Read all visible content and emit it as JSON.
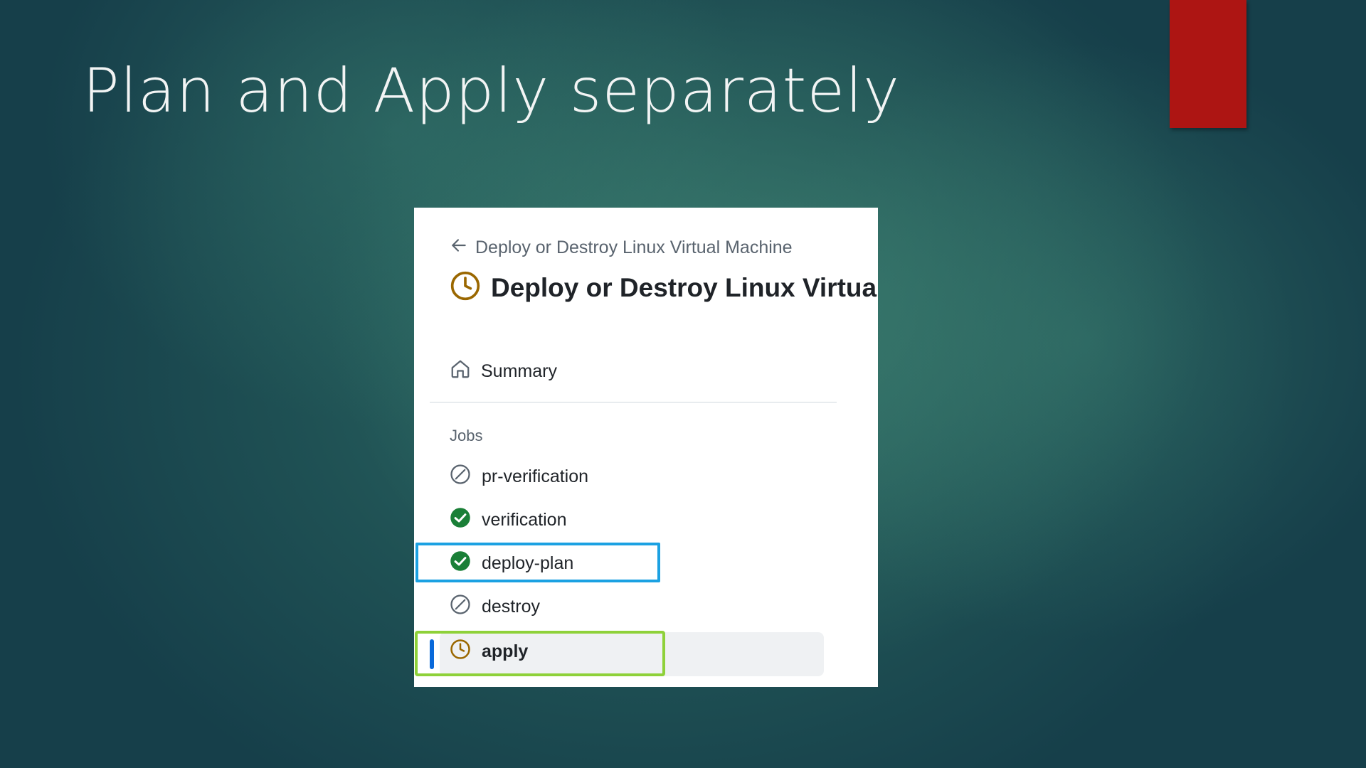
{
  "slide": {
    "title": "Plan and Apply separately"
  },
  "workflow": {
    "back_link": "Deploy or Destroy Linux Virtual Machine",
    "run_title": "Deploy or Destroy Linux Virtual",
    "run_status": "in-progress",
    "summary_label": "Summary",
    "jobs_heading": "Jobs",
    "jobs": [
      {
        "label": "pr-verification",
        "status": "skipped",
        "icon": "skipped-icon"
      },
      {
        "label": "verification",
        "status": "success",
        "icon": "check-circle-icon"
      },
      {
        "label": "deploy-plan",
        "status": "success",
        "icon": "check-circle-icon",
        "highlight": "blue"
      },
      {
        "label": "destroy",
        "status": "skipped",
        "icon": "skipped-icon"
      },
      {
        "label": "apply",
        "status": "in-progress",
        "icon": "clock-icon",
        "highlight": "green",
        "selected": true
      }
    ]
  },
  "colors": {
    "accent_red": "#ad1513",
    "success_green": "#1a7f37",
    "pending_amber": "#9a6700",
    "highlight_blue": "#1ba1e2",
    "highlight_green": "#8ed139",
    "selected_bar": "#0969da"
  }
}
